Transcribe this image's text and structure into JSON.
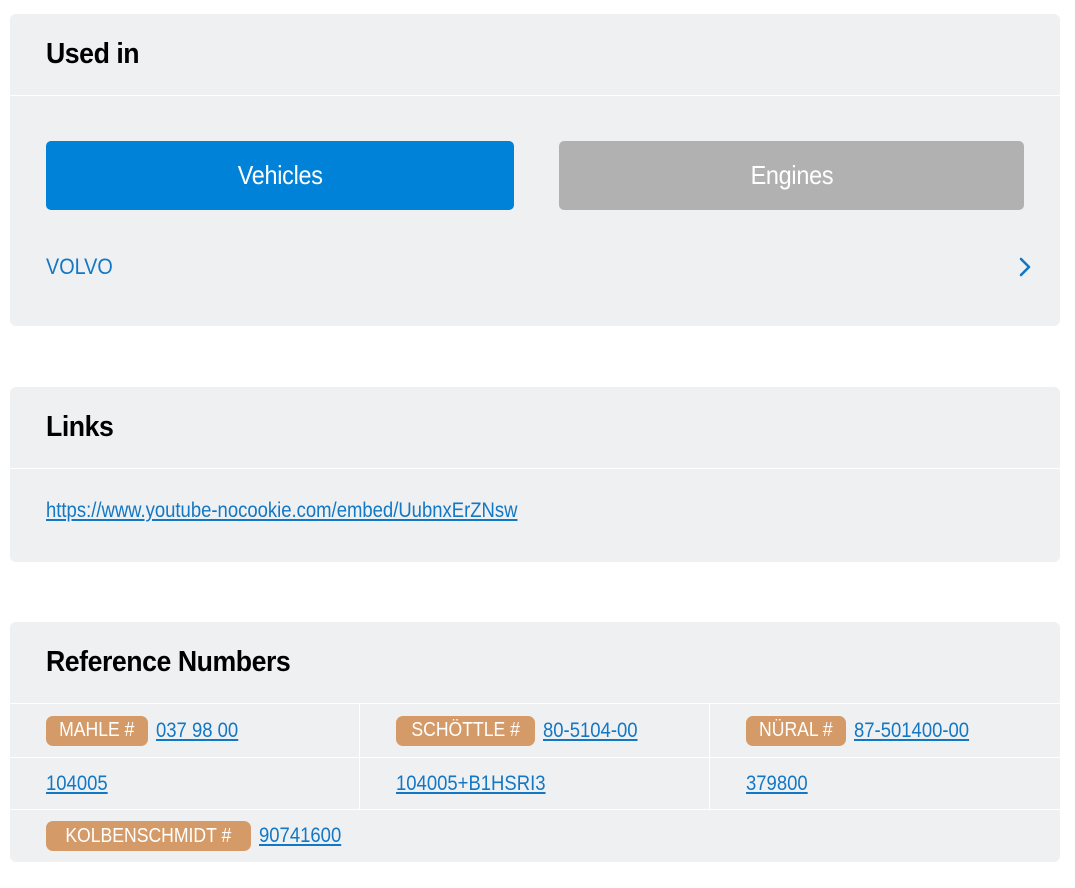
{
  "used_in": {
    "title": "Used in",
    "tabs": [
      {
        "label": "Vehicles",
        "active": true
      },
      {
        "label": "Engines",
        "active": false
      }
    ],
    "makes": [
      {
        "label": "VOLVO"
      }
    ]
  },
  "links": {
    "title": "Links",
    "items": [
      {
        "url": "https://www.youtube-nocookie.com/embed/UubnxErZNsw"
      }
    ]
  },
  "reference_numbers": {
    "title": "Reference Numbers",
    "rows": [
      [
        {
          "brand": "MAHLE #",
          "number": "037 98 00"
        },
        {
          "brand": "SCHÖTTLE #",
          "number": "80-5104-00"
        },
        {
          "brand": "NÜRAL #",
          "number": "87-501400-00"
        }
      ],
      [
        {
          "number": "104005"
        },
        {
          "number": "104005+B1HSRI3"
        },
        {
          "number": "379800"
        }
      ],
      [
        {
          "brand": "KOLBENSCHMIDT #",
          "number": "90741600"
        }
      ]
    ]
  },
  "colors": {
    "accent": "#0082d8",
    "link": "#1277c4",
    "inactive_tab": "#b1b1b1",
    "badge": "#d49a67",
    "card_bg": "#eff0f2"
  },
  "icons": {
    "make_row": "chevron-right-icon"
  }
}
